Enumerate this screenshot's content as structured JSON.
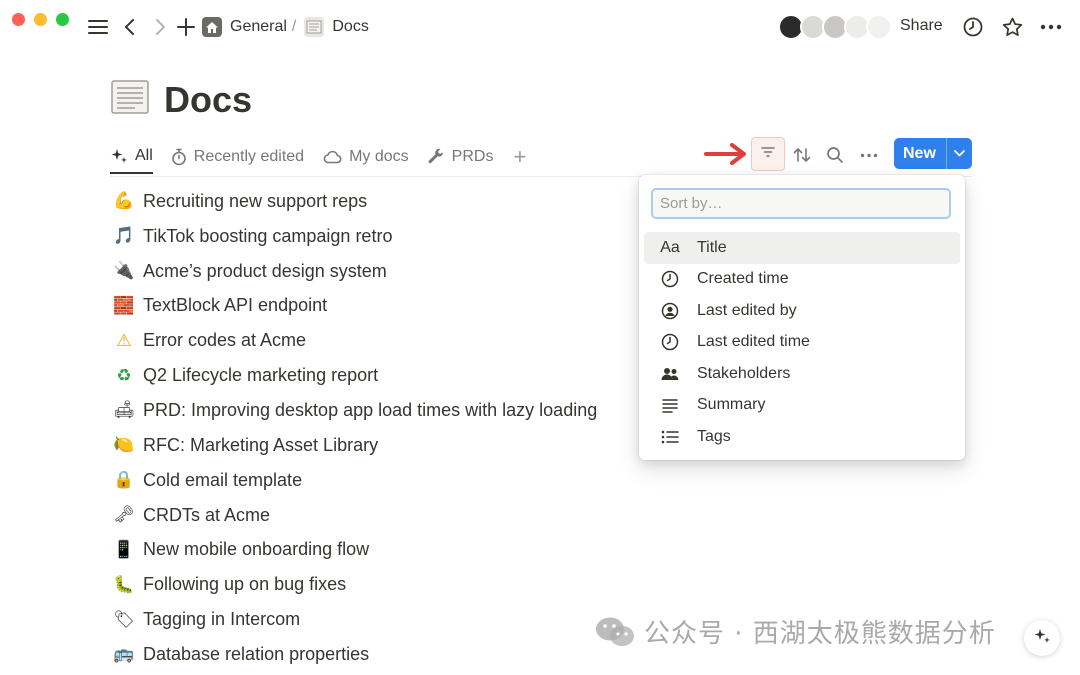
{
  "topbar": {
    "breadcrumb": [
      {
        "label": "General",
        "icon": "home-icon"
      },
      {
        "label": "Docs",
        "icon": "document-icon"
      }
    ],
    "separator": "/",
    "share_label": "Share"
  },
  "page": {
    "title": "Docs",
    "title_icon": "page-icon"
  },
  "tabs": [
    {
      "label": "All",
      "icon": "sparkle-icon",
      "active": true
    },
    {
      "label": "Recently edited",
      "icon": "stopwatch-icon",
      "active": false
    },
    {
      "label": "My docs",
      "icon": "cloud-icon",
      "active": false
    },
    {
      "label": "PRDs",
      "icon": "wrench-icon",
      "active": false
    }
  ],
  "toolbar": {
    "new_label": "New"
  },
  "docs": [
    {
      "emoji": "💪",
      "title": "Recruiting new support reps"
    },
    {
      "emoji": "🎵",
      "title": "TikTok boosting campaign retro"
    },
    {
      "emoji": "🔌",
      "title": "Acme’s product design system"
    },
    {
      "emoji": "🧱",
      "title": "TextBlock API endpoint"
    },
    {
      "emoji": "⚠",
      "title": "Error codes at Acme"
    },
    {
      "emoji": "♻",
      "title": "Q2 Lifecycle marketing report"
    },
    {
      "emoji": "🛋",
      "title": "PRD: Improving desktop app load times with lazy loading"
    },
    {
      "emoji": "🍋",
      "title": "RFC: Marketing Asset Library"
    },
    {
      "emoji": "🔒",
      "title": "Cold email template"
    },
    {
      "emoji": "🗝",
      "title": "CRDTs at Acme"
    },
    {
      "emoji": "📱",
      "title": "New mobile onboarding flow"
    },
    {
      "emoji": "🐛",
      "title": "Following up on bug fixes"
    },
    {
      "emoji": "🏷",
      "title": "Tagging in Intercom"
    },
    {
      "emoji": "🚌",
      "title": "Database relation properties"
    }
  ],
  "sort_menu": {
    "placeholder": "Sort by…",
    "items": [
      {
        "icon_text": "Aa",
        "icon": "text-property-icon",
        "label": "Title"
      },
      {
        "icon_text": "",
        "icon": "clock-icon",
        "label": "Created time"
      },
      {
        "icon_text": "",
        "icon": "person-circle-icon",
        "label": "Last edited by"
      },
      {
        "icon_text": "",
        "icon": "clock-icon",
        "label": "Last edited time"
      },
      {
        "icon_text": "",
        "icon": "people-icon",
        "label": "Stakeholders"
      },
      {
        "icon_text": "",
        "icon": "text-lines-icon",
        "label": "Summary"
      },
      {
        "icon_text": "",
        "icon": "list-icon",
        "label": "Tags"
      }
    ]
  },
  "watermark": {
    "text": "公众号 · 西湖太极熊数据分析"
  },
  "colors": {
    "accent": "#2f80ed",
    "text": "#37352f",
    "muted": "#787774",
    "arrow": "#e03e3e"
  }
}
